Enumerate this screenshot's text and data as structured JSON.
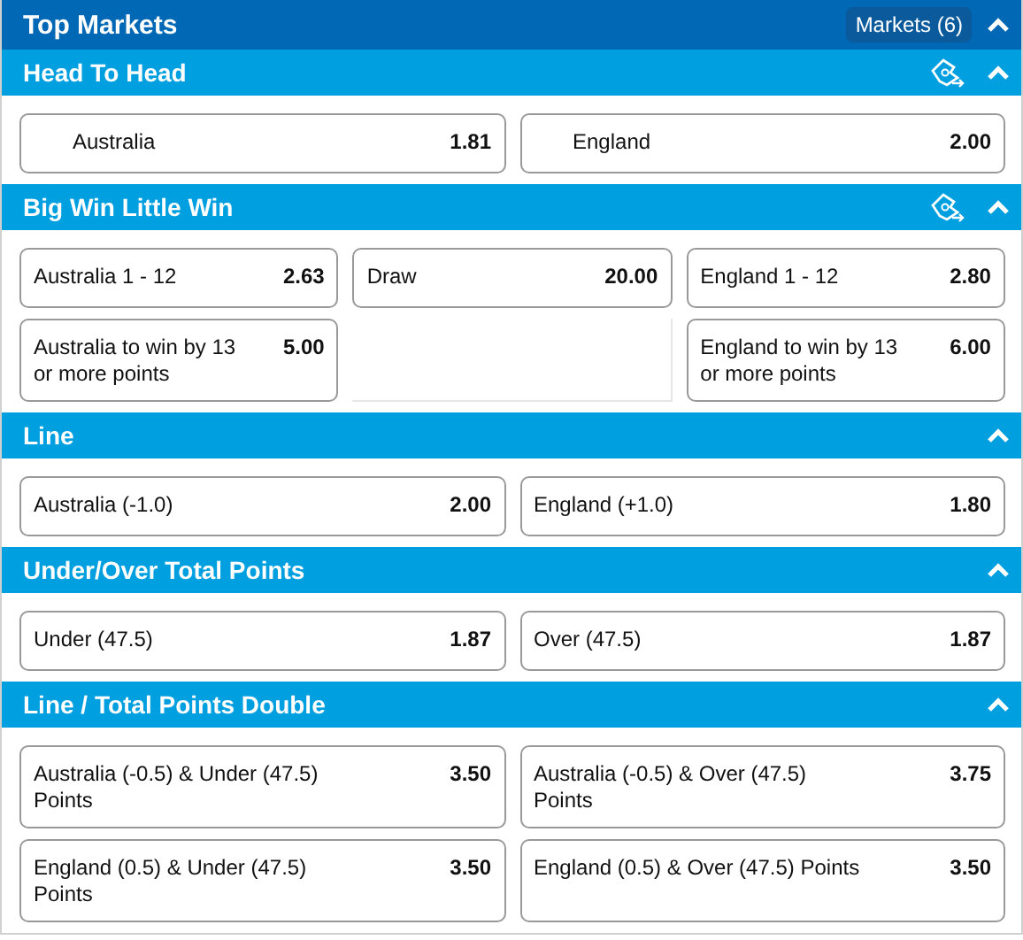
{
  "header": {
    "title": "Top Markets",
    "markets_button": "Markets (6)",
    "expanded": true
  },
  "markets": [
    {
      "title": "Head To Head",
      "expanded": true,
      "ticket_icon": true,
      "kind": "head_to_head",
      "selections": [
        {
          "kind": "selection",
          "label": "Australia",
          "odds": "1.81"
        },
        {
          "kind": "selection",
          "label": "England",
          "odds": "2.00"
        }
      ]
    },
    {
      "title": "Big Win Little Win",
      "expanded": true,
      "ticket_icon": true,
      "kind": "three_way",
      "selections": [
        {
          "kind": "selection",
          "label": "Australia 1 - 12",
          "odds": "2.63"
        },
        {
          "kind": "selection",
          "label": "Draw",
          "odds": "20.00"
        },
        {
          "kind": "selection",
          "label": "England 1 - 12",
          "odds": "2.80"
        },
        {
          "kind": "selection",
          "label": "Australia to win by 13 or more points",
          "odds": "5.00"
        },
        {
          "kind": "empty"
        },
        {
          "kind": "selection",
          "label": "England to win by 13 or more points",
          "odds": "6.00"
        }
      ]
    },
    {
      "title": "Line",
      "expanded": true,
      "ticket_icon": false,
      "kind": "two_way",
      "selections": [
        {
          "kind": "selection",
          "label": "Australia (-1.0)",
          "odds": "2.00"
        },
        {
          "kind": "selection",
          "label": "England (+1.0)",
          "odds": "1.80"
        }
      ]
    },
    {
      "title": "Under/Over Total Points",
      "expanded": true,
      "ticket_icon": false,
      "kind": "two_way",
      "selections": [
        {
          "kind": "selection",
          "label": "Under (47.5)",
          "odds": "1.87"
        },
        {
          "kind": "selection",
          "label": "Over (47.5)",
          "odds": "1.87"
        }
      ]
    },
    {
      "title": "Line / Total Points Double",
      "expanded": true,
      "ticket_icon": false,
      "kind": "two_way",
      "selections": [
        {
          "kind": "selection",
          "label": "Australia (-0.5) & Under (47.5) Points",
          "odds": "3.50"
        },
        {
          "kind": "selection",
          "label": "Australia (-0.5) & Over (47.5) Points",
          "odds": "3.75"
        },
        {
          "kind": "selection",
          "label": "England (0.5) & Under (47.5) Points",
          "odds": "3.50"
        },
        {
          "kind": "selection",
          "label": "England (0.5) & Over (47.5) Points",
          "odds": "3.50"
        }
      ]
    }
  ]
}
